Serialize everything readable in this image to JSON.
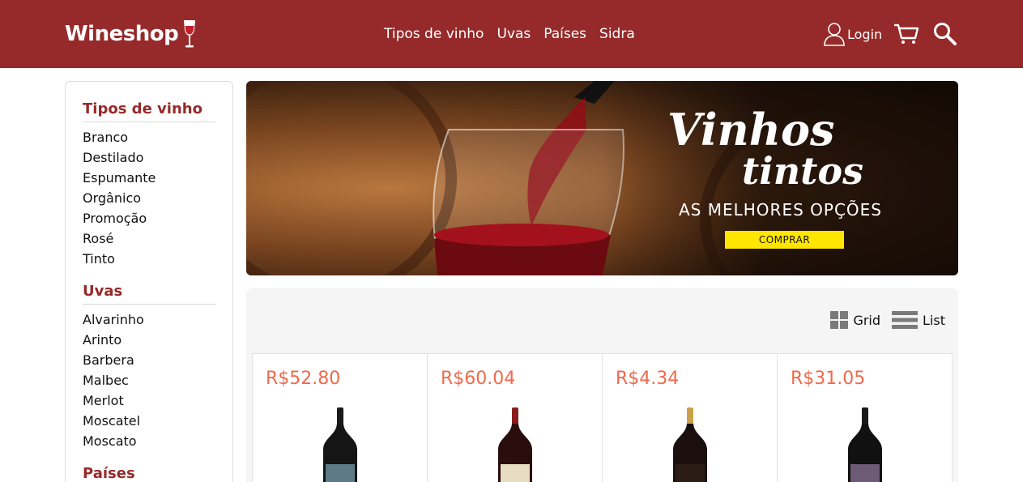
{
  "header": {
    "logo": "Wineshop",
    "nav": [
      "Tipos de vinho",
      "Uvas",
      "Países",
      "Sidra"
    ],
    "login_label": "Login"
  },
  "sidebar": {
    "groups": [
      {
        "title": "Tipos de vinho",
        "items": [
          "Branco",
          "Destilado",
          "Espumante",
          "Orgânico",
          "Promoção",
          "Rosé",
          "Tinto"
        ]
      },
      {
        "title": "Uvas",
        "items": [
          "Alvarinho",
          "Arinto",
          "Barbera",
          "Malbec",
          "Merlot",
          "Moscatel",
          "Moscato"
        ]
      },
      {
        "title": "Países",
        "items": []
      }
    ]
  },
  "banner": {
    "title_line1": "Vinhos",
    "title_line2": "tintos",
    "subtitle": "AS MELHORES OPÇÕES",
    "button": "COMPRAR"
  },
  "view": {
    "grid_label": "Grid",
    "list_label": "List"
  },
  "products": [
    {
      "price": "R$52.80",
      "label_color": "#5d7a86",
      "cap_color": "#1a1a1a"
    },
    {
      "price": "R$60.04",
      "label_color": "#e8dcc2",
      "cap_color": "#8a1c1c"
    },
    {
      "price": "R$4.34",
      "label_color": "#2b1c16",
      "cap_color": "#c9a24a"
    },
    {
      "price": "R$31.05",
      "label_color": "#6d5a75",
      "cap_color": "#1a1a1a"
    }
  ],
  "colors": {
    "brand": "#962a2a",
    "price": "#ef6a4c",
    "button": "#ffe600"
  },
  "icons": [
    "wine-glass-icon",
    "user-icon",
    "cart-icon",
    "search-icon",
    "grid-icon",
    "list-icon"
  ]
}
